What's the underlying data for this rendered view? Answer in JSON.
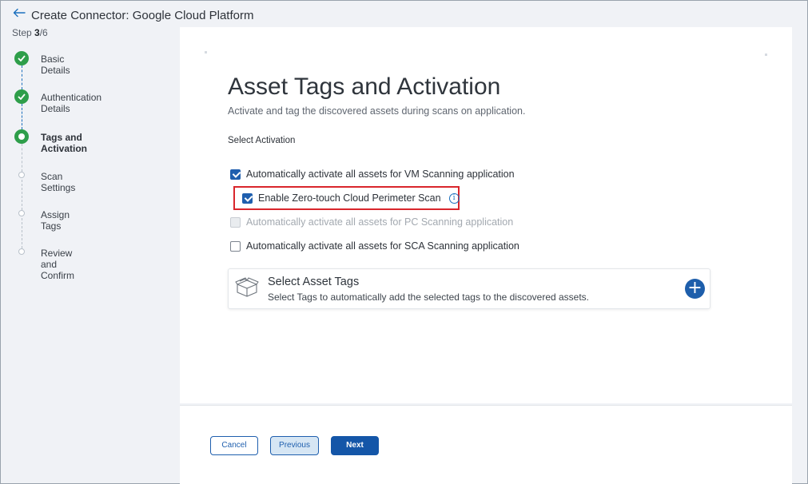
{
  "header": {
    "title": "Create Connector: Google Cloud Platform",
    "step_prefix": "Step",
    "step_current": "3",
    "step_total": "/6"
  },
  "stepper": {
    "steps": [
      {
        "label": "Basic Details",
        "status": "done"
      },
      {
        "label": "Authentication Details",
        "status": "done"
      },
      {
        "label": "Tags and Activation",
        "status": "active"
      },
      {
        "label": "Scan Settings",
        "status": "pending"
      },
      {
        "label": "Assign Tags",
        "status": "pending"
      },
      {
        "label": "Review and Confirm",
        "status": "pending"
      }
    ]
  },
  "main": {
    "title": "Asset Tags and Activation",
    "subtitle": "Activate and tag the discovered assets during scans on application.",
    "section_label": "Select Activation",
    "options": [
      {
        "label": "Automatically activate all assets for VM Scanning application",
        "checked": true,
        "disabled": false
      },
      {
        "label": "Enable Zero-touch Cloud Perimeter Scan",
        "checked": true,
        "disabled": false
      },
      {
        "label": "Automatically activate all assets for PC Scanning application",
        "checked": false,
        "disabled": true
      },
      {
        "label": "Automatically activate all assets for SCA Scanning application",
        "checked": false,
        "disabled": false
      }
    ],
    "asset_tags": {
      "title": "Select Asset Tags",
      "description": "Select Tags to automatically add the selected tags to the discovered assets."
    }
  },
  "footer": {
    "cancel_label": "Cancel",
    "previous_label": "Previous",
    "next_label": "Next"
  },
  "colors": {
    "accent": "#1f5fae",
    "success": "#2e9e4a",
    "highlight": "#d9262c"
  }
}
